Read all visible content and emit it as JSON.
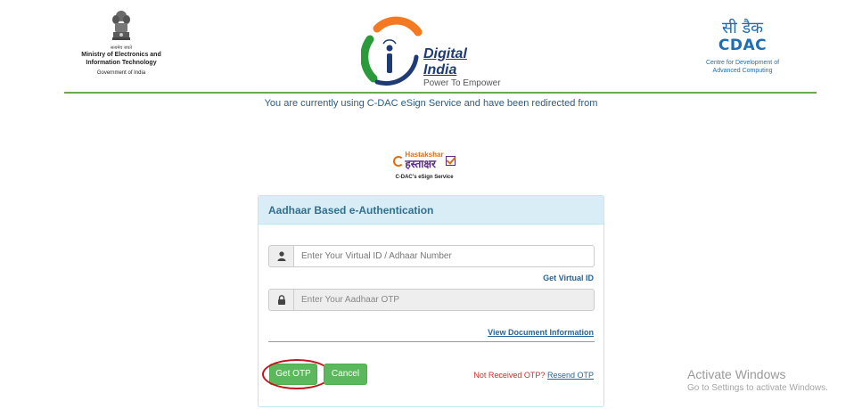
{
  "header": {
    "ministry": {
      "hindi_caption": "सत्यमेव जयते",
      "line1": "Ministry of Electronics and",
      "line1b": "Information Technology",
      "line2": "Government of India"
    },
    "digital_india": {
      "title": "Digital India",
      "tagline": "Power To Empower"
    },
    "cdac": {
      "hindi": "सी डैक",
      "latin": "CDAC",
      "desc1": "Centre for Development of",
      "desc2": "Advanced Computing"
    }
  },
  "redirect_text": "You are currently using C-DAC eSign Service and have been redirected from",
  "hastakshar": {
    "english": "Hastakshar",
    "hindi": "हस्ताक्षर",
    "subtitle": "C-DAC's eSign Service"
  },
  "panel": {
    "title": "Aadhaar Based e-Authentication",
    "id_placeholder": "Enter Your Virtual ID / Adhaar Number",
    "id_value": "",
    "get_virtual_id": "Get Virtual ID",
    "otp_placeholder": "Enter Your Aadhaar OTP",
    "otp_value": "",
    "view_document": "View Document Information",
    "get_otp_label": "Get OTP",
    "cancel_label": "Cancel",
    "not_received": "Not Received OTP?",
    "resend_otp": "Resend OTP"
  },
  "watermark": {
    "title": "Activate Windows",
    "subtitle": "Go to Settings to activate Windows."
  },
  "icons": {
    "user": "user-icon",
    "lock": "lock-icon"
  },
  "colors": {
    "panel_header_bg": "#d9edf7",
    "panel_title": "#31708f",
    "button_green": "#5cb85c",
    "highlight_ring": "#c0161c",
    "divider_green": "#6aa84f",
    "link_blue": "#2a6496",
    "alert_red": "#c9302c"
  }
}
